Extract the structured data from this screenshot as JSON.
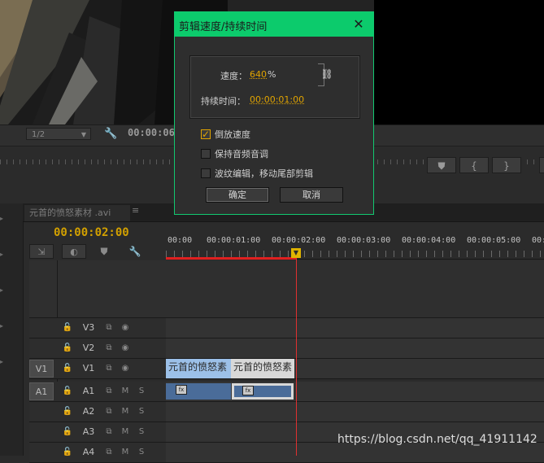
{
  "source_monitor": {
    "zoom": "1/2",
    "timecode": "00:00:06"
  },
  "dialog": {
    "title": "剪辑速度/持续时间",
    "close_glyph": "✕",
    "speed_label": "速度：",
    "speed_value": "640",
    "speed_unit": "%",
    "duration_label": "持续时间：",
    "duration_value": "00:00:01:00",
    "checkboxes": [
      {
        "label": "倒放速度",
        "checked": true
      },
      {
        "label": "保持音频音调",
        "checked": false
      },
      {
        "label": "波纹编辑，移动尾部剪辑",
        "checked": false
      }
    ],
    "ok_label": "确定",
    "cancel_label": "取消"
  },
  "timeline": {
    "tab_label": "元首的愤怒素材 .avi",
    "tab_close": "≡",
    "timecode": "00:00:02:00",
    "ruler_labels": [
      "00:00",
      "00:00:01:00",
      "00:00:02:00",
      "00:00:03:00",
      "00:00:04:00",
      "00:00:05:00",
      "00:00"
    ],
    "playhead_seconds": 2,
    "tracks": [
      {
        "id": "V3",
        "target": ""
      },
      {
        "id": "V2",
        "target": ""
      },
      {
        "id": "V1",
        "target": "V1"
      },
      {
        "id": "A1",
        "target": "A1"
      },
      {
        "id": "A2",
        "target": ""
      },
      {
        "id": "A3",
        "target": ""
      },
      {
        "id": "A4",
        "target": ""
      }
    ],
    "clips": [
      {
        "track": "V1",
        "label": "元首的愤怒素",
        "color": "#9cc0e8"
      },
      {
        "track": "V1",
        "label": "元首的愤怒素",
        "color": "#d8d8d8"
      }
    ],
    "audio_mute": "M",
    "audio_solo": "S",
    "fx_label": "fx"
  },
  "watermark": "https://blog.csdn.net/qq_41911142",
  "colors": {
    "dialog_title_bg": "#0ccb6c",
    "value_accent": "#e0a300",
    "playhead": "#e03030"
  }
}
